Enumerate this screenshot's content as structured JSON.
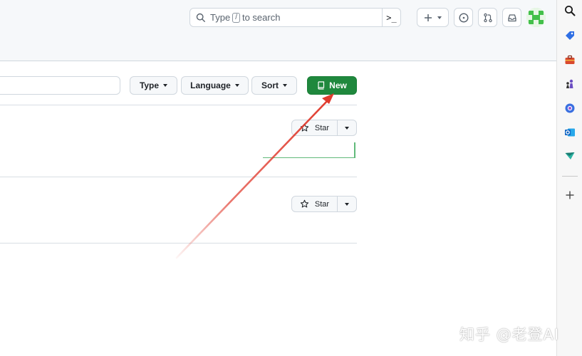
{
  "header": {
    "search": {
      "prefix": "Type",
      "kbd": "/",
      "suffix": "to search",
      "command_glyph": ">_"
    },
    "create_button": {
      "icon": "plus-icon"
    },
    "issues_button": {
      "icon": "issue-opened-icon"
    },
    "pulls_button": {
      "icon": "git-pull-request-icon"
    },
    "inbox_button": {
      "icon": "inbox-icon"
    },
    "avatar": {
      "icon": "identicon-avatar"
    }
  },
  "filters": {
    "type_label": "Type",
    "language_label": "Language",
    "sort_label": "Sort",
    "new_label": "New"
  },
  "repos": [
    {
      "star_label": "Star"
    },
    {
      "star_label": "Star"
    }
  ],
  "edge_sidebar": {
    "items": [
      "search-icon",
      "tag-icon",
      "toolbox-icon",
      "chess-icon",
      "copilot-icon",
      "outlook-icon",
      "send-icon",
      "add-icon"
    ]
  },
  "watermark": {
    "text": "知乎 @老登AI"
  },
  "colors": {
    "primary_green": "#1f883d",
    "arrow_red": "#e03a2d",
    "header_bg": "#f6f8fa",
    "border": "#d0d7de"
  }
}
